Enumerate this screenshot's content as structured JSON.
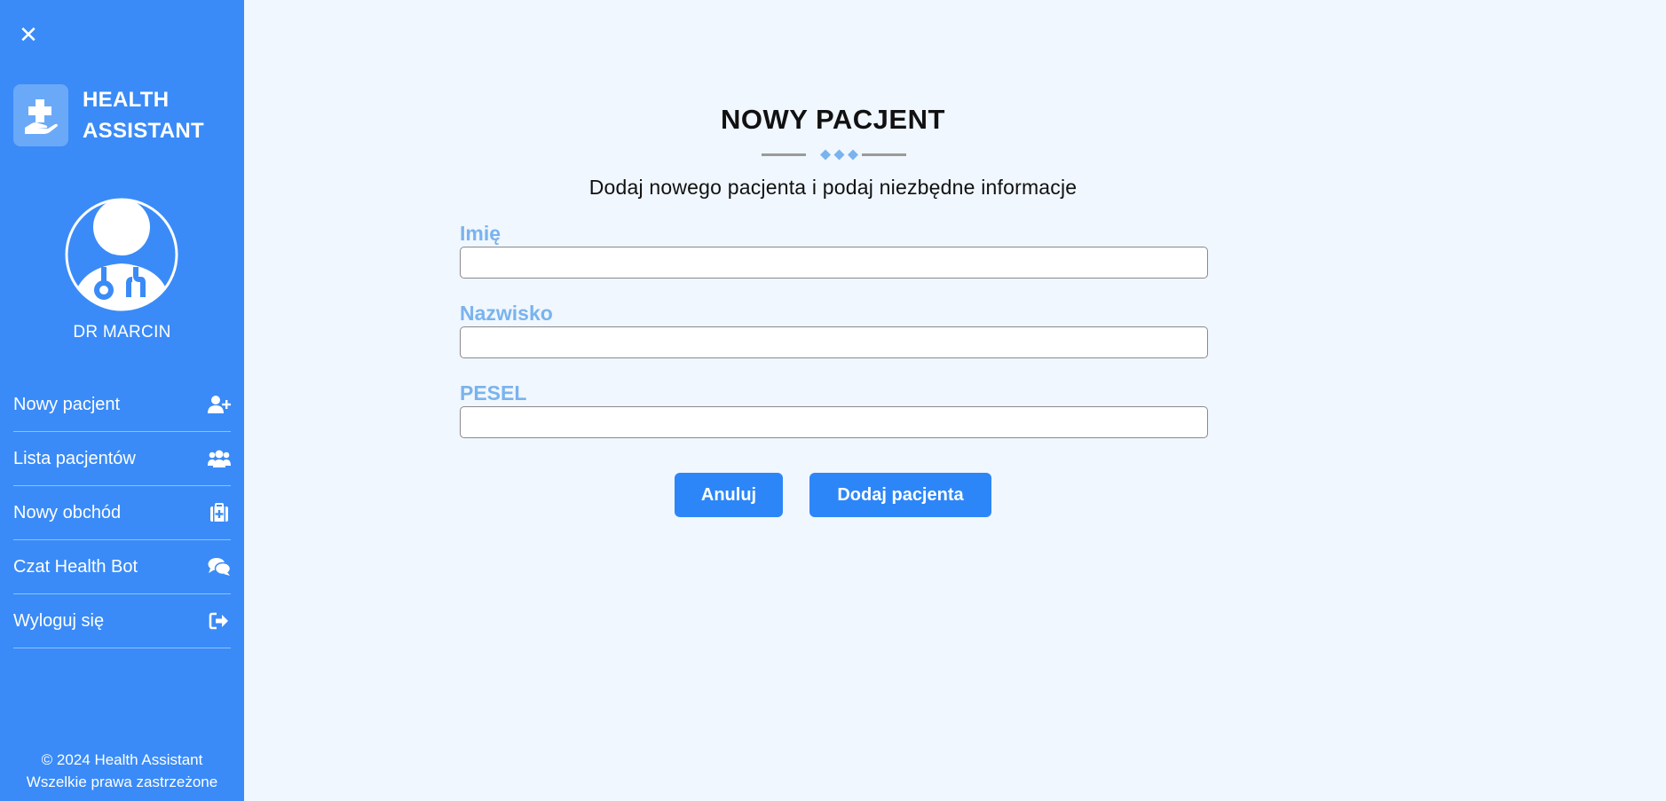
{
  "sidebar": {
    "close_icon": "close-icon",
    "brand_line1": "HEALTH",
    "brand_line2": "ASSISTANT",
    "brand_icon": "hand-holding-medical-icon",
    "doctor_name": "DR MARCIN",
    "items": [
      {
        "label": "Nowy pacjent",
        "icon": "user-plus-icon"
      },
      {
        "label": "Lista pacjentów",
        "icon": "users-icon"
      },
      {
        "label": "Nowy obchód",
        "icon": "medkit-icon"
      },
      {
        "label": "Czat Health Bot",
        "icon": "comments-icon"
      },
      {
        "label": "Wyloguj się",
        "icon": "sign-out-icon"
      }
    ],
    "footer_line1": "© 2024 Health Assistant",
    "footer_line2": "Wszelkie prawa zastrzeżone"
  },
  "main": {
    "title": "NOWY PACJENT",
    "subtitle": "Dodaj nowego pacjenta i podaj niezbędne informacje",
    "fields": [
      {
        "label": "Imię",
        "value": "",
        "placeholder": ""
      },
      {
        "label": "Nazwisko",
        "value": "",
        "placeholder": ""
      },
      {
        "label": "PESEL",
        "value": "",
        "placeholder": ""
      }
    ],
    "cancel_label": "Anuluj",
    "submit_label": "Dodaj pacjenta"
  },
  "colors": {
    "sidebar_bg": "#3a8bf7",
    "page_bg": "#f0f7fe",
    "label_color": "#7ab3ee",
    "button_bg": "#2d86f7"
  }
}
